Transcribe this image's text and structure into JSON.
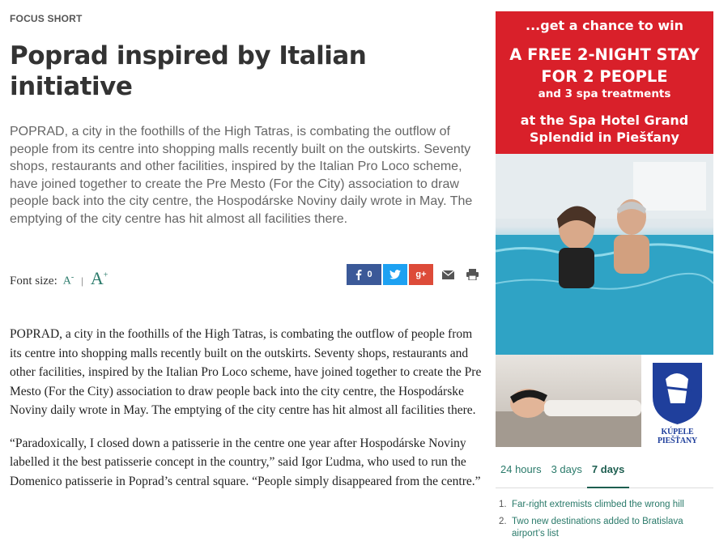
{
  "article": {
    "kicker": "FOCUS SHORT",
    "title": "Poprad inspired by Italian initiative",
    "lead": "POPRAD, a city in the foothills of the High Tatras, is combating the outflow of people from its centre into shopping malls recently built on the outskirts. Seventy shops, restaurants and other facilities, inspired by the Italian Pro Loco scheme, have joined together to create the Pre Mesto (For the City) association to draw people back into the city centre, the Hospodárske Noviny daily wrote in May. The emptying of the city centre has hit almost all facilities there.",
    "font_size": {
      "label": "Font size:",
      "small": "A",
      "small_sup": "-",
      "separator": "|",
      "big": "A",
      "big_sup": "+"
    },
    "share": {
      "facebook_count": "0",
      "facebook_icon": "facebook-icon",
      "twitter_icon": "twitter-icon",
      "googleplus_label": "g+",
      "mail_icon": "mail-icon",
      "print_icon": "print-icon"
    },
    "paragraphs": [
      "POPRAD, a city in the foothills of the High Tatras, is combating the outflow of people from its centre into shopping malls recently built on the outskirts. Seventy shops, restaurants and other facilities, inspired by the Italian Pro Loco scheme, have joined together to create the Pre Mesto (For the City) association to draw people back into the city centre, the Hospodárske Noviny daily wrote in May. The emptying of the city centre has hit almost all facilities there.",
      "“Paradoxically, I closed down a patisserie in the centre one year after Hospodárske Noviny labelled it the best patisserie concept in the country,” said Igor Ľudma, who used to run the Domenico patisserie in Poprad’s central square. “People simply disappeared from the centre.”"
    ]
  },
  "ad": {
    "line1": "...get a chance to win",
    "line2": "A FREE 2-NIGHT STAY FOR 2 PEOPLE",
    "line3": "and 3 spa treatments",
    "line4": "at the Spa Hotel Grand Splendid in Piešťany",
    "logo_text": "KÚPELE PIEŠŤANY",
    "colors": {
      "banner": "#d9202a",
      "logo": "#1f3f9c"
    }
  },
  "most_read": {
    "tabs": [
      "24 hours",
      "3 days",
      "7 days"
    ],
    "active_tab": "7 days",
    "items": [
      {
        "num": "1.",
        "title": "Far-right extremists climbed the wrong hill"
      },
      {
        "num": "2.",
        "title": "Two new destinations added to Bratislava airport’s list"
      }
    ]
  },
  "colors": {
    "accent": "#2a7a6a",
    "facebook": "#3b5998",
    "twitter": "#1da1f2",
    "googleplus": "#dd4b39"
  }
}
